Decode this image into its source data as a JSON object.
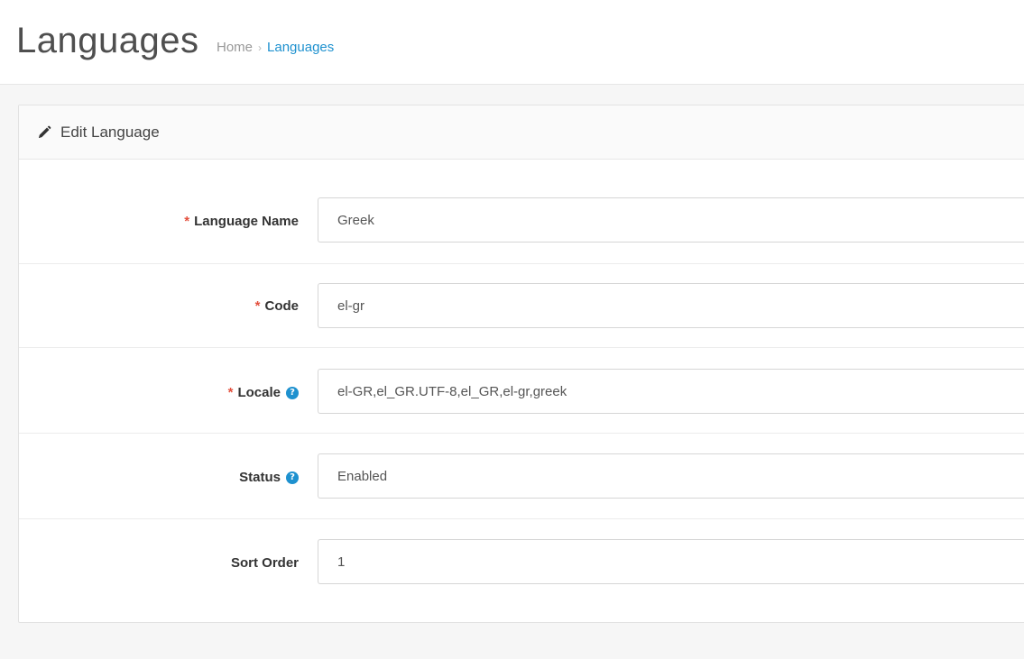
{
  "header": {
    "title": "Languages",
    "breadcrumb": {
      "home": "Home",
      "separator": "›",
      "current": "Languages"
    }
  },
  "panel": {
    "icon": "pencil-icon",
    "title": "Edit Language"
  },
  "form": {
    "language_name": {
      "label": "Language Name",
      "required": true,
      "value": "Greek"
    },
    "code": {
      "label": "Code",
      "required": true,
      "value": "el-gr"
    },
    "locale": {
      "label": "Locale",
      "required": true,
      "help_icon": "question-circle-icon",
      "value": "el-GR,el_GR.UTF-8,el_GR,el-gr,greek"
    },
    "status": {
      "label": "Status",
      "help_icon": "question-circle-icon",
      "value": "Enabled"
    },
    "sort_order": {
      "label": "Sort Order",
      "value": "1"
    },
    "required_marker": "*",
    "help_marker": "?"
  },
  "colors": {
    "accent": "#1e91cf",
    "required": "#e3503e",
    "label": "#333333",
    "background": "#f6f6f6"
  }
}
